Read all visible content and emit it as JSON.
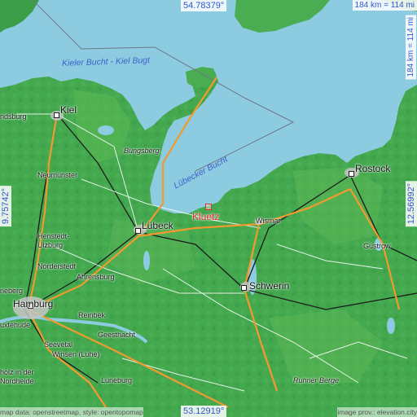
{
  "map": {
    "coordinates": {
      "top_lat": "54.78379°",
      "bottom_lat": "53.12919°",
      "left_lon": "9.75742°",
      "right_lon": "12.56992°"
    },
    "scale": {
      "top": "184 km = 114 mi",
      "right": "184 km = 114 mi"
    },
    "attribution": {
      "left": "map data: openstreetmap, style: opentopomap",
      "right": "image prov.: elevation.city"
    },
    "target": {
      "name": "Kluetz",
      "marker": "square-marker"
    },
    "water_labels": {
      "kiel_bay": "Kieler Bucht - Kiel Bugt",
      "luebeck_bay": "Lübecker Bucht"
    },
    "cities": {
      "kiel": "Kiel",
      "rostock": "Rostock",
      "luebeck": "Lübeck",
      "schwerin": "Schwerin",
      "hamburg": "Hamburg"
    },
    "towns": {
      "rendsburg": "ndsburg",
      "neumuenster": "Neumünster",
      "wismar": "Wismar",
      "guestrow": "Güstrow",
      "henstedt": "Henstedt-\nUlzburg",
      "norderstedt": "Norderstedt",
      "ahrensburg": "Ahrensburg",
      "pinneberg": "neberg",
      "reinbek": "Reinbek",
      "geesthacht": "Geesthacht",
      "buxtehude": "uxtehude",
      "seevetal": "Seevetal",
      "winsen": "Winsen (Luhe)",
      "buchholz": "holz in der\nNordheide",
      "lueneburg": "Lüneburg"
    },
    "places": {
      "bungsberg": "Bungsberg",
      "ruhner_berge": "Ruhner Berge"
    },
    "colors": {
      "water": "#8ccbe0",
      "land": "#3fa34d",
      "highland": "#5db956",
      "motorway": "#f29a2e",
      "road": "#ffffff",
      "rail": "#1a1a1a",
      "target": "#e8262e",
      "coord_text": "#3355cc"
    }
  }
}
